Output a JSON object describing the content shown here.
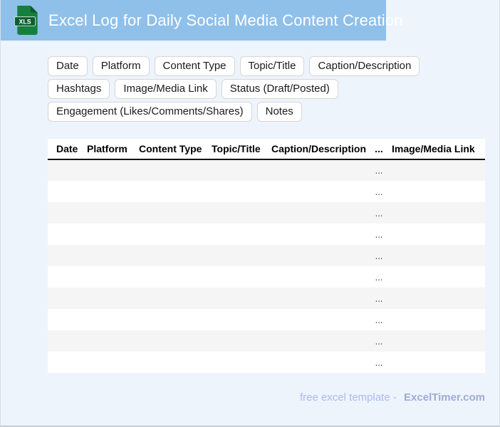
{
  "header": {
    "title": "Excel Log for Daily Social Media Content Creation",
    "icon_label": "XLS"
  },
  "chips": [
    "Date",
    "Platform",
    "Content Type",
    "Topic/Title",
    "Caption/Description",
    "Hashtags",
    "Image/Media Link",
    "Status (Draft/Posted)",
    "Engagement (Likes/Comments/Shares)",
    "Notes"
  ],
  "table": {
    "columns": [
      "Date",
      "Platform",
      "Content Type",
      "Topic/Title",
      "Caption/Description",
      "...",
      "Image/Media Link"
    ],
    "ellipsis_column_index": 5,
    "rows": [
      [
        "",
        "",
        "",
        "",
        "",
        "...",
        ""
      ],
      [
        "",
        "",
        "",
        "",
        "",
        "...",
        ""
      ],
      [
        "",
        "",
        "",
        "",
        "",
        "...",
        ""
      ],
      [
        "",
        "",
        "",
        "",
        "",
        "...",
        ""
      ],
      [
        "",
        "",
        "",
        "",
        "",
        "...",
        ""
      ],
      [
        "",
        "",
        "",
        "",
        "",
        "...",
        ""
      ],
      [
        "",
        "",
        "",
        "",
        "",
        "...",
        ""
      ],
      [
        "",
        "",
        "",
        "",
        "",
        "...",
        ""
      ],
      [
        "",
        "",
        "",
        "",
        "",
        "...",
        ""
      ],
      [
        "",
        "",
        "",
        "",
        "",
        "...",
        ""
      ]
    ]
  },
  "footer": {
    "text": "free excel template -",
    "brand": "ExcelTimer.com"
  },
  "colors": {
    "header_bg": "#8FC0EA",
    "page_bg": "#EDF4FC",
    "row_alt": "#F5F5F5",
    "footer_text": "#ADB9EC",
    "footer_brand": "#9FABD6",
    "icon_green": "#15803D",
    "icon_dark_green": "#0B5E31"
  }
}
